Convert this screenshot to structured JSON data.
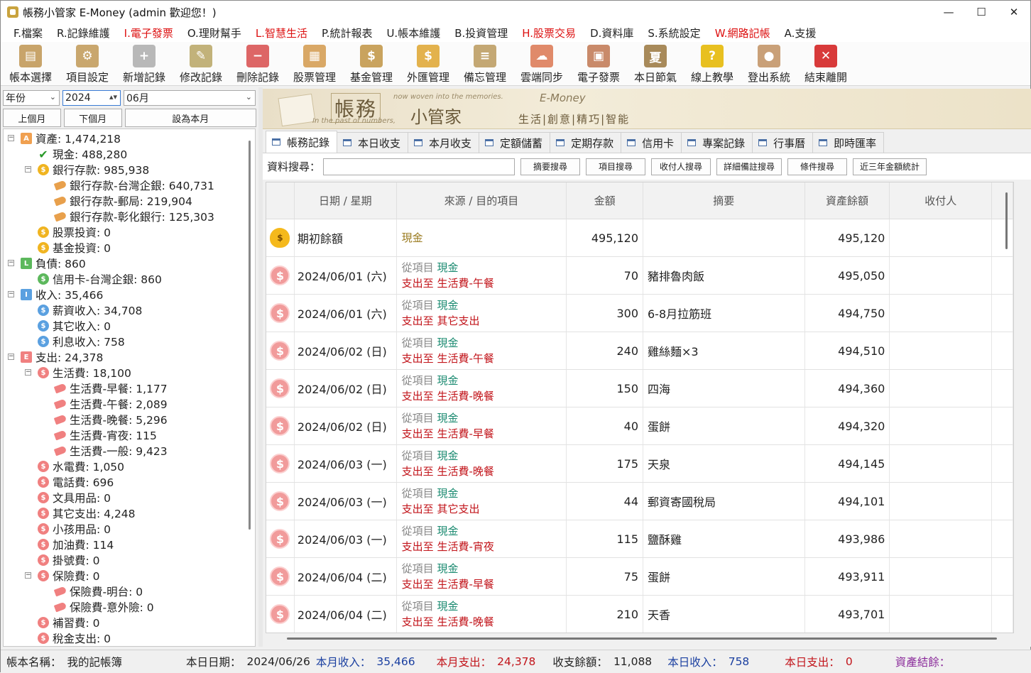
{
  "window": {
    "title": "帳務小管家 E-Money (admin 歡迎您！)",
    "min": "—",
    "max": "☐",
    "close": "✕"
  },
  "menu": [
    {
      "label": "F.檔案",
      "red": false
    },
    {
      "label": "R.記錄維護",
      "red": false
    },
    {
      "label": "I.電子發票",
      "red": true
    },
    {
      "label": "O.理財幫手",
      "red": false
    },
    {
      "label": "L.智慧生活",
      "red": true
    },
    {
      "label": "P.統計報表",
      "red": false
    },
    {
      "label": "U.帳本維護",
      "red": false
    },
    {
      "label": "B.投資管理",
      "red": false
    },
    {
      "label": "H.股票交易",
      "red": true
    },
    {
      "label": "D.資料庫",
      "red": false
    },
    {
      "label": "S.系統設定",
      "red": false
    },
    {
      "label": "W.網路記帳",
      "red": true
    },
    {
      "label": "A.支援",
      "red": false
    }
  ],
  "toolbar": [
    {
      "label": "帳本選擇",
      "icon": "book-icon",
      "color": "#c8a46a",
      "glyph": "▤"
    },
    {
      "label": "項目設定",
      "icon": "gear-icon",
      "color": "#c9a76e",
      "glyph": "⚙"
    },
    {
      "label": "新增記錄",
      "icon": "add-doc-icon",
      "color": "#b8b8b8",
      "glyph": "+"
    },
    {
      "label": "修改記錄",
      "icon": "edit-doc-icon",
      "color": "#c2b27a",
      "glyph": "✎"
    },
    {
      "label": "刪除記錄",
      "icon": "delete-doc-icon",
      "color": "#d66",
      "glyph": "−"
    },
    {
      "label": "股票管理",
      "icon": "stock-icon",
      "color": "#d9a866",
      "glyph": "▦"
    },
    {
      "label": "基金管理",
      "icon": "fund-icon",
      "color": "#c9a35e",
      "glyph": "$"
    },
    {
      "label": "外匯管理",
      "icon": "forex-icon",
      "color": "#e3b24d",
      "glyph": "$"
    },
    {
      "label": "備忘管理",
      "icon": "memo-icon",
      "color": "#c4a874",
      "glyph": "≡"
    },
    {
      "label": "雲端同步",
      "icon": "cloud-sync-icon",
      "color": "#e08a6a",
      "glyph": "☁"
    },
    {
      "label": "電子發票",
      "icon": "qrcode-icon",
      "color": "#c98a6a",
      "glyph": "▣"
    },
    {
      "label": "本日節氣",
      "icon": "solar-term-icon",
      "color": "#a88a5a",
      "glyph": "夏"
    },
    {
      "label": "線上教學",
      "icon": "help-icon",
      "color": "#e8c020",
      "glyph": "?"
    },
    {
      "label": "登出系統",
      "icon": "logout-icon",
      "color": "#c9a078",
      "glyph": "●"
    },
    {
      "label": "結束離開",
      "icon": "exit-icon",
      "color": "#d83a3a",
      "glyph": "✕"
    }
  ],
  "left": {
    "year_label": "年份",
    "year_value": "2024",
    "month_value": "06月",
    "prev_month": "上個月",
    "next_month": "下個月",
    "set_month": "設為本月"
  },
  "tree": [
    {
      "label": "資產: 1,474,218",
      "lvl": 0,
      "icon": "A",
      "color": "#f0a050",
      "exp": "−",
      "shape": "sq"
    },
    {
      "label": "現金: 488,280",
      "lvl": 1,
      "icon": "✔",
      "color": "#2a9a2a",
      "shape": "chk"
    },
    {
      "label": "銀行存款: 985,938",
      "lvl": 1,
      "icon": "$",
      "color": "#f0b420",
      "exp": "−",
      "shape": "c"
    },
    {
      "label": "銀行存款-台灣企銀: 640,731",
      "lvl": 2,
      "icon": "",
      "color": "#e8a04c",
      "shape": "tag"
    },
    {
      "label": "銀行存款-郵局: 219,904",
      "lvl": 2,
      "icon": "",
      "color": "#e8a04c",
      "shape": "tag"
    },
    {
      "label": "銀行存款-彰化銀行: 125,303",
      "lvl": 2,
      "icon": "",
      "color": "#e8a04c",
      "shape": "tag"
    },
    {
      "label": "股票投資: 0",
      "lvl": 1,
      "icon": "$",
      "color": "#f0b420",
      "shape": "c"
    },
    {
      "label": "基金投資: 0",
      "lvl": 1,
      "icon": "$",
      "color": "#f0b420",
      "shape": "c"
    },
    {
      "label": "負債: 860",
      "lvl": 0,
      "icon": "L",
      "color": "#5cb85c",
      "exp": "−",
      "shape": "sq"
    },
    {
      "label": "信用卡-台灣企銀: 860",
      "lvl": 1,
      "icon": "$",
      "color": "#5cb85c",
      "shape": "c"
    },
    {
      "label": "收入: 35,466",
      "lvl": 0,
      "icon": "I",
      "color": "#5aa0e0",
      "exp": "−",
      "shape": "sq"
    },
    {
      "label": "薪資收入: 34,708",
      "lvl": 1,
      "icon": "$",
      "color": "#5aa0e0",
      "shape": "c"
    },
    {
      "label": "其它收入: 0",
      "lvl": 1,
      "icon": "$",
      "color": "#5aa0e0",
      "shape": "c"
    },
    {
      "label": "利息收入: 758",
      "lvl": 1,
      "icon": "$",
      "color": "#5aa0e0",
      "shape": "c"
    },
    {
      "label": "支出: 24,378",
      "lvl": 0,
      "icon": "E",
      "color": "#f08080",
      "exp": "−",
      "shape": "sq"
    },
    {
      "label": "生活費: 18,100",
      "lvl": 1,
      "icon": "$",
      "color": "#f08080",
      "exp": "−",
      "shape": "c"
    },
    {
      "label": "生活費-早餐: 1,177",
      "lvl": 2,
      "icon": "",
      "color": "#f08080",
      "shape": "tag"
    },
    {
      "label": "生活費-午餐: 2,089",
      "lvl": 2,
      "icon": "",
      "color": "#f08080",
      "shape": "tag"
    },
    {
      "label": "生活費-晚餐: 5,296",
      "lvl": 2,
      "icon": "",
      "color": "#f08080",
      "shape": "tag"
    },
    {
      "label": "生活費-宵夜: 115",
      "lvl": 2,
      "icon": "",
      "color": "#f08080",
      "shape": "tag"
    },
    {
      "label": "生活費-一般: 9,423",
      "lvl": 2,
      "icon": "",
      "color": "#f08080",
      "shape": "tag"
    },
    {
      "label": "水電費: 1,050",
      "lvl": 1,
      "icon": "$",
      "color": "#f08080",
      "shape": "c"
    },
    {
      "label": "電話費: 696",
      "lvl": 1,
      "icon": "$",
      "color": "#f08080",
      "shape": "c"
    },
    {
      "label": "文具用品: 0",
      "lvl": 1,
      "icon": "$",
      "color": "#f08080",
      "shape": "c"
    },
    {
      "label": "其它支出: 4,248",
      "lvl": 1,
      "icon": "$",
      "color": "#f08080",
      "shape": "c"
    },
    {
      "label": "小孩用品: 0",
      "lvl": 1,
      "icon": "$",
      "color": "#f08080",
      "shape": "c"
    },
    {
      "label": "加油費: 114",
      "lvl": 1,
      "icon": "$",
      "color": "#f08080",
      "shape": "c"
    },
    {
      "label": "掛號費: 0",
      "lvl": 1,
      "icon": "$",
      "color": "#f08080",
      "shape": "c"
    },
    {
      "label": "保險費: 0",
      "lvl": 1,
      "icon": "$",
      "color": "#f08080",
      "exp": "−",
      "shape": "c"
    },
    {
      "label": "保險費-明台: 0",
      "lvl": 2,
      "icon": "",
      "color": "#f08080",
      "shape": "tag"
    },
    {
      "label": "保險費-意外險: 0",
      "lvl": 2,
      "icon": "",
      "color": "#f08080",
      "shape": "tag"
    },
    {
      "label": "補習費: 0",
      "lvl": 1,
      "icon": "$",
      "color": "#f08080",
      "shape": "c"
    },
    {
      "label": "稅金支出: 0",
      "lvl": 1,
      "icon": "$",
      "color": "#f08080",
      "shape": "c"
    }
  ],
  "banner": {
    "title_big": "帳務",
    "title_mid": "小管家",
    "tagline1": "now woven into the memories.",
    "tagline2": "In the past of numbers,",
    "brand": "E-Money",
    "slogan": "生活|創意|精巧|智能"
  },
  "tabs": [
    "帳務記錄",
    "本日收支",
    "本月收支",
    "定額儲蓄",
    "定期存款",
    "信用卡",
    "專案記錄",
    "行事曆",
    "即時匯率"
  ],
  "search": {
    "label": "資料搜尋：",
    "buttons": [
      "摘要搜尋",
      "項目搜尋",
      "收付人搜尋",
      "詳細備註搜尋",
      "條件搜尋",
      "近三年金額統計"
    ]
  },
  "grid": {
    "headers": [
      "",
      "日期 / 星期",
      "來源 / 目的項目",
      "金額",
      "摘要",
      "資產餘額",
      "收付人",
      ""
    ],
    "opening": {
      "label": "期初餘額",
      "item": "現金",
      "amount": "495,120",
      "balance": "495,120"
    },
    "from_label": "從項目",
    "to_label": "支出至",
    "rows": [
      {
        "date": "2024/06/01 (六)",
        "from": "現金",
        "to": "生活費-午餐",
        "amount": "70",
        "memo": "豬排魯肉飯",
        "balance": "495,050"
      },
      {
        "date": "2024/06/01 (六)",
        "from": "現金",
        "to": "其它支出",
        "amount": "300",
        "memo": "6-8月拉筋班",
        "balance": "494,750"
      },
      {
        "date": "2024/06/02 (日)",
        "from": "現金",
        "to": "生活費-午餐",
        "amount": "240",
        "memo": "雞絲麵×3",
        "balance": "494,510"
      },
      {
        "date": "2024/06/02 (日)",
        "from": "現金",
        "to": "生活費-晚餐",
        "amount": "150",
        "memo": "四海",
        "balance": "494,360"
      },
      {
        "date": "2024/06/02 (日)",
        "from": "現金",
        "to": "生活費-早餐",
        "amount": "40",
        "memo": "蛋餅",
        "balance": "494,320"
      },
      {
        "date": "2024/06/03 (一)",
        "from": "現金",
        "to": "生活費-晚餐",
        "amount": "175",
        "memo": "天泉",
        "balance": "494,145"
      },
      {
        "date": "2024/06/03 (一)",
        "from": "現金",
        "to": "其它支出",
        "amount": "44",
        "memo": "郵資寄國稅局",
        "balance": "494,101"
      },
      {
        "date": "2024/06/03 (一)",
        "from": "現金",
        "to": "生活費-宵夜",
        "amount": "115",
        "memo": "鹽酥雞",
        "balance": "493,986"
      },
      {
        "date": "2024/06/04 (二)",
        "from": "現金",
        "to": "生活費-早餐",
        "amount": "75",
        "memo": "蛋餅",
        "balance": "493,911"
      },
      {
        "date": "2024/06/04 (二)",
        "from": "現金",
        "to": "生活費-晚餐",
        "amount": "210",
        "memo": "天香",
        "balance": "493,701"
      }
    ]
  },
  "status": {
    "book_label": "帳本名稱：",
    "book_value": "我的記帳簿",
    "today_label": "本日日期：",
    "today_value": "2024/06/26",
    "month_income_label": "本月收入：",
    "month_income_value": "35,466",
    "month_expense_label": "本月支出：",
    "month_expense_value": "24,378",
    "net_label": "收支餘額：",
    "net_value": "11,088",
    "day_income_label": "本日收入：",
    "day_income_value": "758",
    "day_expense_label": "本日支出：",
    "day_expense_value": "0",
    "asset_label": "資產結餘："
  }
}
